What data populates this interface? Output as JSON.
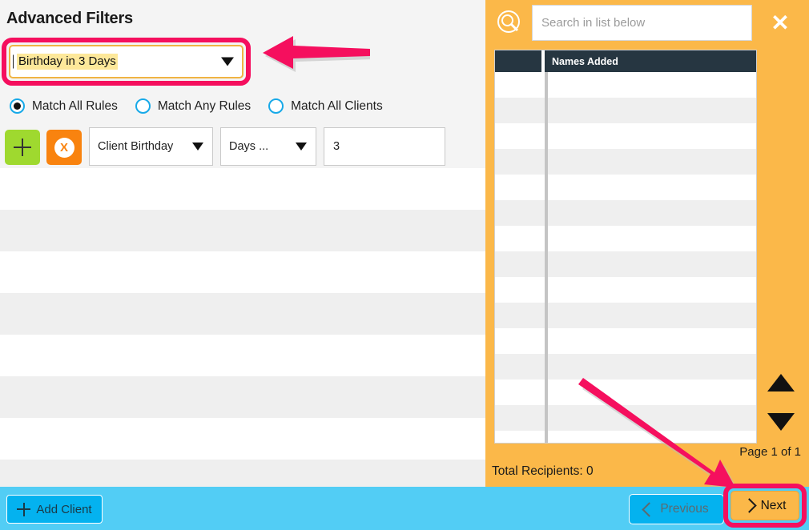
{
  "left": {
    "title": "Advanced Filters",
    "preset": {
      "value": "Birthday in 3 Days",
      "caret_icon": "chevron-down-icon"
    },
    "match_options": [
      {
        "label": "Match All Rules",
        "selected": true
      },
      {
        "label": "Match Any Rules",
        "selected": false
      },
      {
        "label": "Match All Clients",
        "selected": false
      }
    ],
    "rule": {
      "add_icon": "plus-icon",
      "delete_icon": "x-circle-icon",
      "field": "Client Birthday",
      "operator": "Days ...",
      "value": "3"
    },
    "empty_row_count": 8
  },
  "right": {
    "search_icon": "search-icon",
    "search_placeholder": "Search in list below",
    "search_value": "",
    "close_icon": "close-icon",
    "table": {
      "columns": [
        "",
        "Names Added"
      ],
      "rows": [],
      "empty_row_count": 15
    },
    "scroll_up_icon": "triangle-up-icon",
    "scroll_down_icon": "triangle-down-icon",
    "page_indicator": "Page 1 of 1",
    "total_recipients": "Total Recipients: 0"
  },
  "footer": {
    "add_client_label": "Add Client",
    "add_client_icon": "plus-icon",
    "previous_label": "Previous",
    "previous_icon": "chevron-left-icon",
    "next_label": "Next",
    "next_icon": "chevron-right-icon"
  },
  "annotations": {
    "arrow_color": "#f50f5e",
    "highlight_ring_color": "#f50f5e",
    "arrow_left_target": "preset-filter-dropdown",
    "arrow_diagonal_target": "next-button"
  },
  "colors": {
    "panel_background": "#f4f4f4",
    "orange_panel": "#fbb849",
    "footer_blue": "#52cdf5",
    "button_blue": "#04b2ef",
    "table_header": "#263641",
    "add_rule_green": "#9fd92f",
    "delete_rule_orange": "#f9830f",
    "radio_blue": "#17a9e8",
    "highlight_yellow": "#fde89a"
  }
}
